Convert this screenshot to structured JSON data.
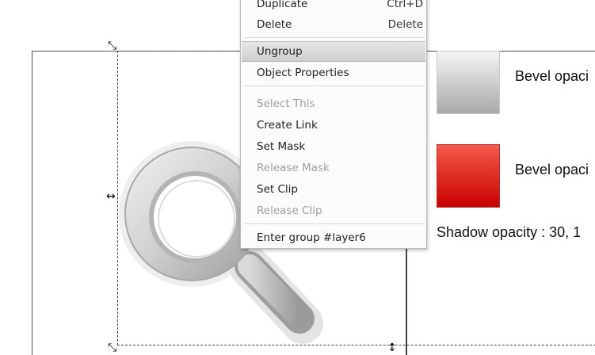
{
  "canvas": {
    "swatch_grey_color": "#bdbdbd",
    "swatch_red_color": "#e0221b",
    "label_bevel_1": "Bevel opaci",
    "label_bevel_2": "Bevel opaci",
    "label_shadow": "Shadow opacity : 30, 1"
  },
  "handles": {
    "top_left": "⤡",
    "middle_left": "↔",
    "bottom_left": "⤡",
    "bottom_middle": "↕"
  },
  "context_menu": {
    "items": [
      {
        "label": "Duplicate",
        "shortcut": "Ctrl+D",
        "disabled": false
      },
      {
        "label": "Delete",
        "shortcut": "Delete",
        "disabled": false
      },
      {
        "label": "Ungroup",
        "shortcut": "",
        "disabled": false,
        "highlighted": true
      },
      {
        "label": "Object Properties",
        "shortcut": "",
        "disabled": false
      },
      {
        "label": "Select This",
        "shortcut": "",
        "disabled": true
      },
      {
        "label": "Create Link",
        "shortcut": "",
        "disabled": false
      },
      {
        "label": "Set Mask",
        "shortcut": "",
        "disabled": false
      },
      {
        "label": "Release Mask",
        "shortcut": "",
        "disabled": true
      },
      {
        "label": "Set Clip",
        "shortcut": "",
        "disabled": false
      },
      {
        "label": "Release Clip",
        "shortcut": "",
        "disabled": true
      },
      {
        "label": "Enter group #layer6",
        "shortcut": "",
        "disabled": false
      }
    ]
  }
}
